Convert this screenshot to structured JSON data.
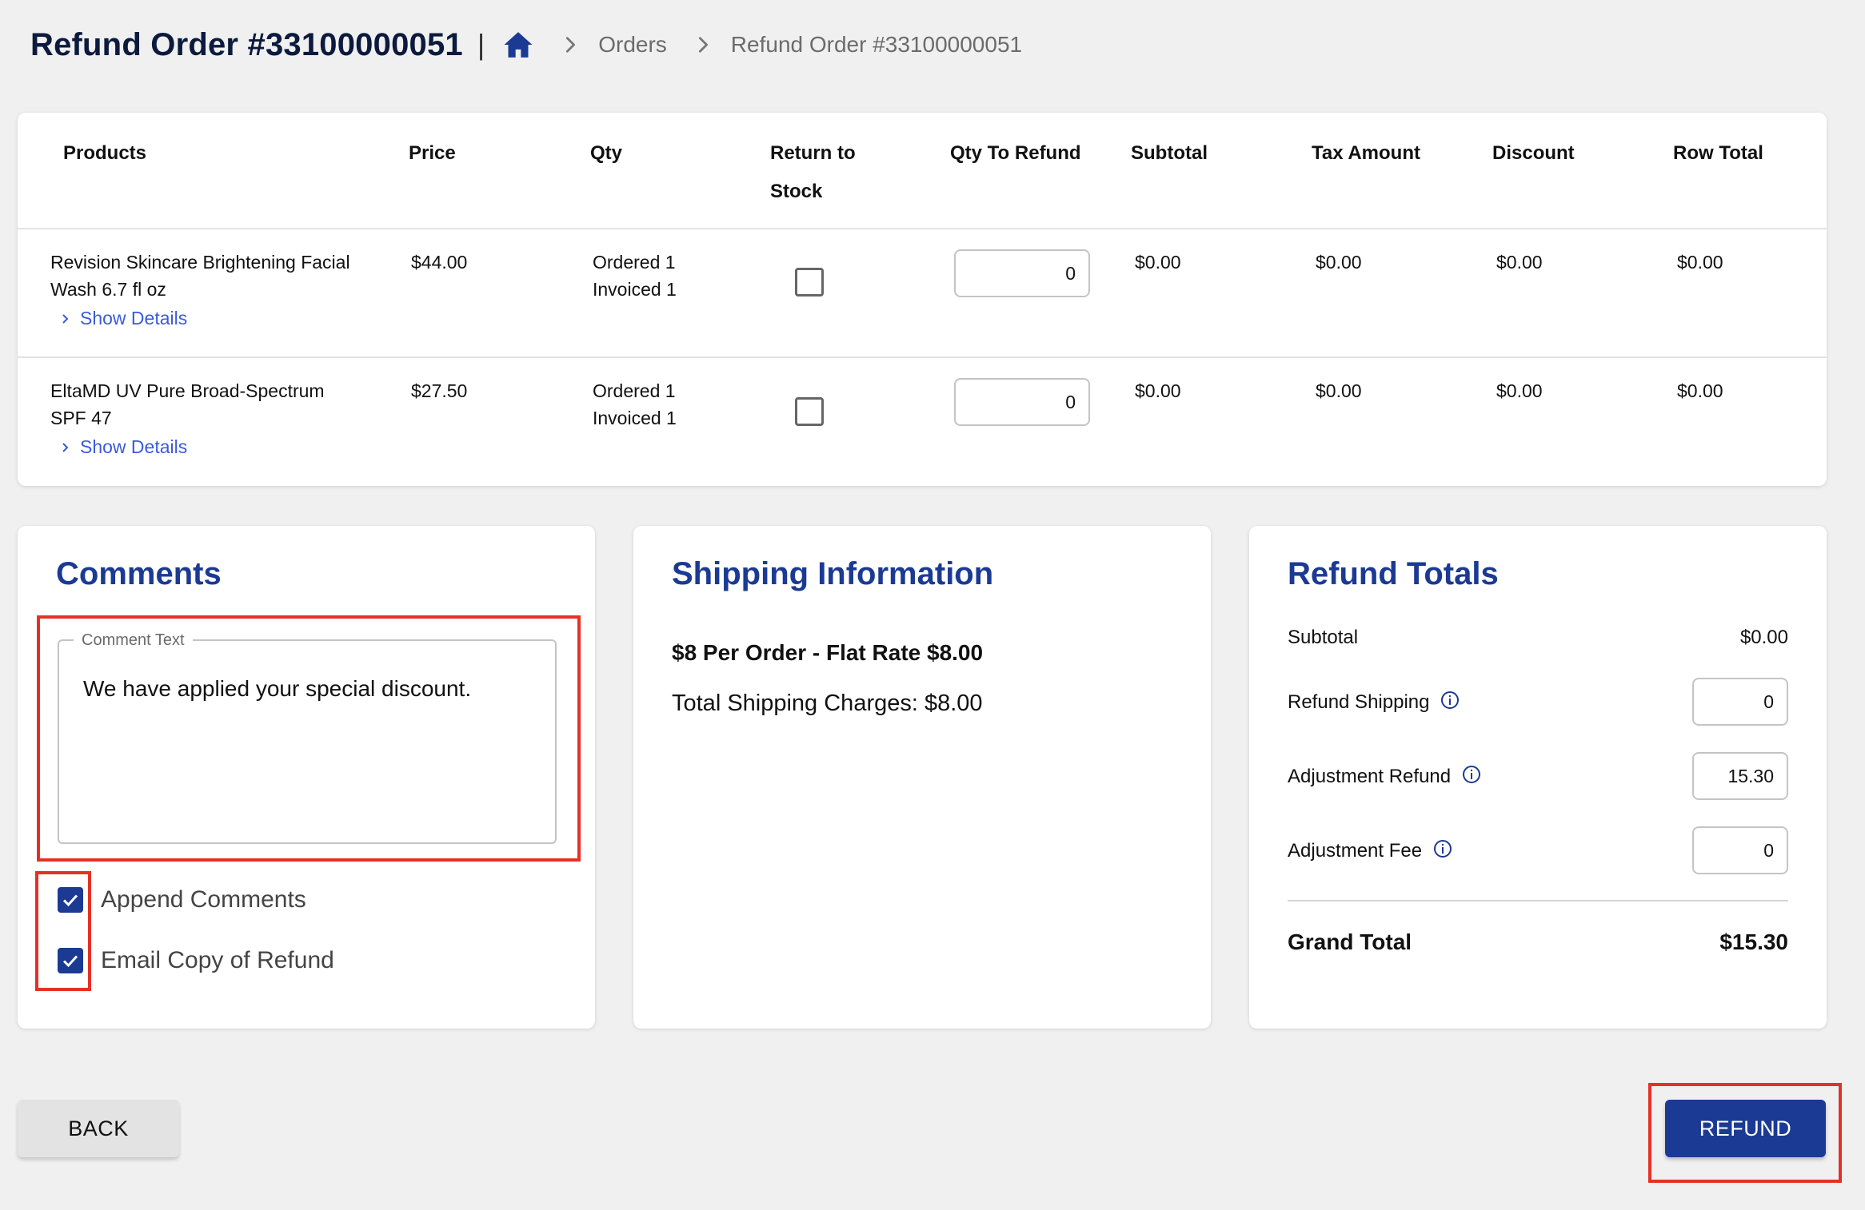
{
  "header": {
    "title": "Refund Order #33100000051",
    "separator": "|",
    "home_icon": "home-icon",
    "breadcrumbs": [
      "Orders",
      "Refund Order #33100000051"
    ]
  },
  "colors": {
    "primary": "#1b3a94",
    "title": "#0b1a3d",
    "link": "#3a5bd9",
    "highlight": "#e53125",
    "background": "#f0f0f0"
  },
  "items_table": {
    "columns": [
      "Products",
      "Price",
      "Qty",
      "Return to Stock",
      "Qty To Refund",
      "Subtotal",
      "Tax Amount",
      "Discount",
      "Row Total"
    ],
    "rows": [
      {
        "product_line1": "Revision Skincare Brightening Facial",
        "product_line2": "Wash 6.7 fl oz",
        "show_details": "Show Details",
        "price": "$44.00",
        "qty_ordered": "Ordered 1",
        "qty_invoiced": "Invoiced 1",
        "return_to_stock": false,
        "qty_to_refund": "0",
        "subtotal": "$0.00",
        "tax_amount": "$0.00",
        "discount": "$0.00",
        "row_total": "$0.00"
      },
      {
        "product_line1": "EltaMD UV Pure Broad-Spectrum",
        "product_line2": "SPF 47",
        "show_details": "Show Details",
        "price": "$27.50",
        "qty_ordered": "Ordered 1",
        "qty_invoiced": "Invoiced 1",
        "return_to_stock": false,
        "qty_to_refund": "0",
        "subtotal": "$0.00",
        "tax_amount": "$0.00",
        "discount": "$0.00",
        "row_total": "$0.00"
      }
    ]
  },
  "comments": {
    "title": "Comments",
    "field_label": "Comment Text",
    "text": "We have applied your special discount.",
    "append_comments": {
      "label": "Append Comments",
      "checked": true
    },
    "email_copy": {
      "label": "Email Copy of Refund",
      "checked": true
    }
  },
  "shipping": {
    "title": "Shipping Information",
    "method": "$8 Per Order - Flat Rate $8.00",
    "total_charges": "Total Shipping Charges: $8.00"
  },
  "totals": {
    "title": "Refund Totals",
    "subtotal_label": "Subtotal",
    "subtotal_value": "$0.00",
    "refund_shipping_label": "Refund Shipping",
    "refund_shipping_value": "0",
    "adjustment_refund_label": "Adjustment Refund",
    "adjustment_refund_value": "15.30",
    "adjustment_fee_label": "Adjustment Fee",
    "adjustment_fee_value": "0",
    "grand_total_label": "Grand Total",
    "grand_total_value": "$15.30"
  },
  "actions": {
    "back_label": "BACK",
    "refund_label": "REFUND"
  }
}
